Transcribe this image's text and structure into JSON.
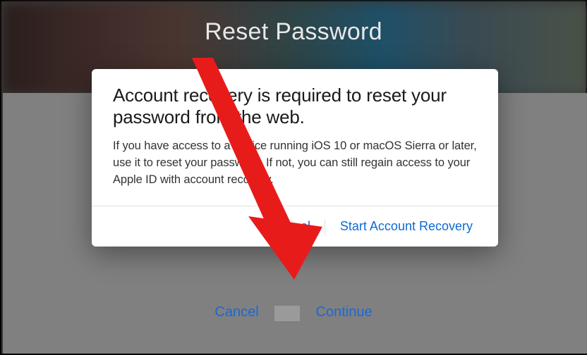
{
  "page": {
    "title": "Reset Password"
  },
  "underlay": {
    "cancel": "Cancel",
    "continue": "Continue"
  },
  "modal": {
    "heading": "Account recovery is required to reset your password from the web.",
    "body": "If you have access to a device running iOS 10 or macOS Sierra or later, use it to reset your password. If not, you can still regain access to your Apple ID with account recovery.",
    "cancel": "Cancel",
    "start": "Start Account Recovery"
  }
}
